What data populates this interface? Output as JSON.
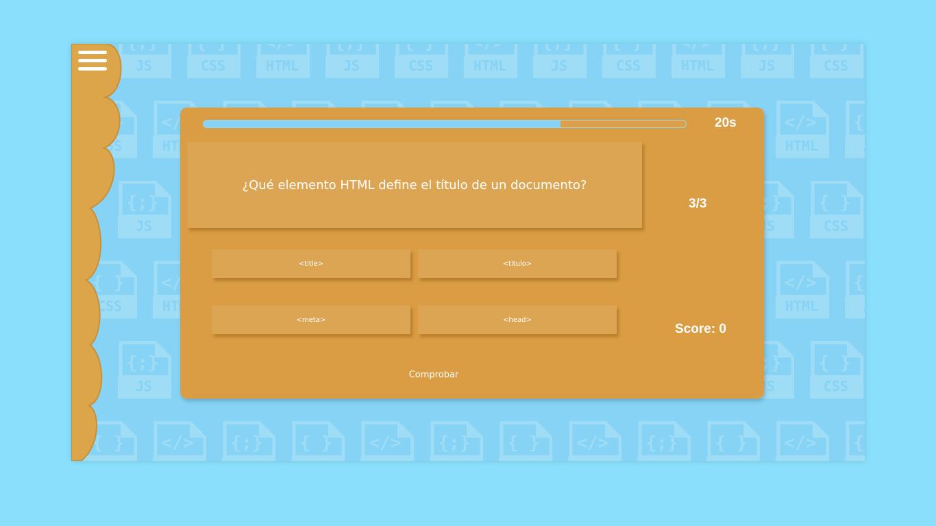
{
  "background": {
    "tile_labels": [
      "JS",
      "CSS",
      "HTML"
    ],
    "tile_icons": [
      "braces-semicolon-icon",
      "braces-icon",
      "code-tag-icon"
    ]
  },
  "menu": {
    "icon": "hamburger-menu-icon"
  },
  "quiz": {
    "timer": "20s",
    "progress": 0.74,
    "question": "¿Qué elemento HTML define el título de un documento?",
    "counter": "3/3",
    "score": "Score: 0",
    "options": [
      "<title>",
      "<titulo>",
      "<meta>",
      "<head>"
    ],
    "check_label": "Comprobar"
  },
  "colors": {
    "page_bg": "#8ae0fc",
    "stage_bg": "#86d3f5",
    "tile": "#9fdcf5",
    "card": "#db9d43",
    "panel": "#dca554",
    "scallop": "#dca54a",
    "progress_fill": "#86d3f5",
    "text": "#ffffff"
  }
}
